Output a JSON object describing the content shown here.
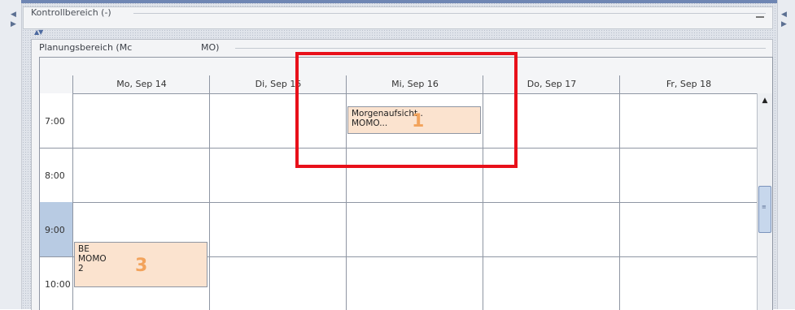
{
  "kontroll": {
    "title": "Kontrollbereich (-)"
  },
  "planung": {
    "title_start": "Planungsbereich (Mc",
    "title_end": "MO)"
  },
  "days": [
    "Mo, Sep 14",
    "Di, Sep 15",
    "Mi, Sep 16",
    "Do, Sep 17",
    "Fr, Sep 18"
  ],
  "times": [
    "7:00",
    "8:00",
    "9:00",
    "10:00"
  ],
  "appointments": [
    {
      "line1": "Morgenaufsicht..",
      "line2": "MOMO...",
      "number": "1"
    },
    {
      "line1": "BE",
      "line2": "MOMO",
      "line3": "2",
      "number": "3"
    }
  ],
  "glyphs": {
    "left_arrow": "◀",
    "right_arrow": "▶",
    "collapse": "▲▼",
    "scroll_up": "▲",
    "grip": "≡"
  },
  "colors": {
    "highlight": "#e8101a",
    "appointment_bg": "#fbe3cf",
    "selected_time": "#b8cbe3",
    "number": "#f2a35c"
  }
}
